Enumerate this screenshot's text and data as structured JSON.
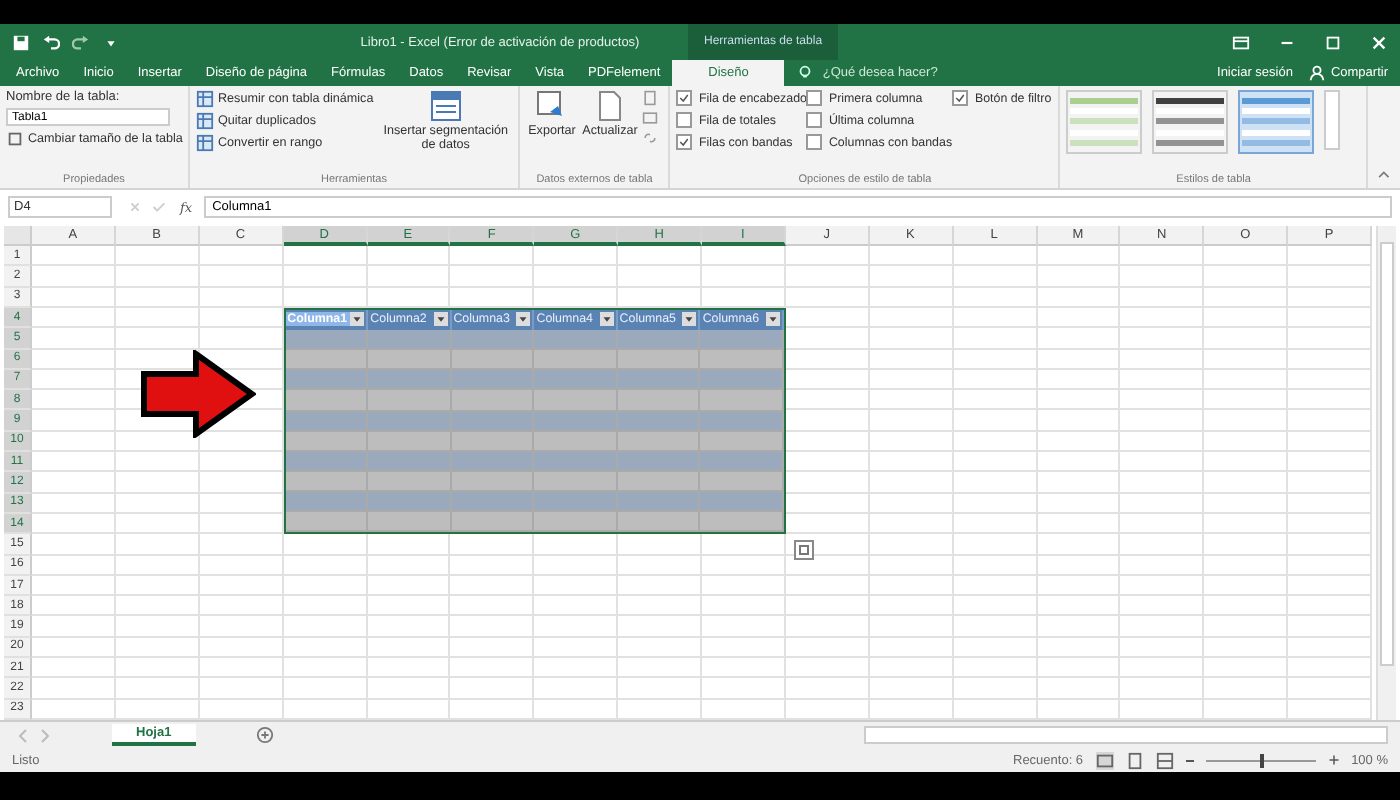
{
  "title_bar": {
    "title": "Libro1 - Excel (Error de activación de productos)",
    "contextual_tab": "Herramientas de tabla",
    "sign_in": "Iniciar sesión",
    "share": "Compartir"
  },
  "ribbon_tabs": [
    {
      "label": "Archivo",
      "selected": false
    },
    {
      "label": "Inicio",
      "selected": false
    },
    {
      "label": "Insertar",
      "selected": false
    },
    {
      "label": "Diseño de página",
      "selected": false
    },
    {
      "label": "Fórmulas",
      "selected": false
    },
    {
      "label": "Datos",
      "selected": false
    },
    {
      "label": "Revisar",
      "selected": false
    },
    {
      "label": "Vista",
      "selected": false
    },
    {
      "label": "PDFelement",
      "selected": false
    },
    {
      "label": "Diseño",
      "selected": true
    }
  ],
  "tell_me": {
    "placeholder": "¿Qué desea hacer?"
  },
  "properties": {
    "name_label": "Nombre de la tabla:",
    "name_value": "Tabla1",
    "resize": "Cambiar tamaño de la tabla",
    "group": "Propiedades"
  },
  "tools": {
    "items": [
      "Resumir con tabla dinámica",
      "Quitar duplicados",
      "Convertir en rango"
    ],
    "slicer": "Insertar segmentación de datos",
    "group": "Herramientas"
  },
  "external": {
    "export": "Exportar",
    "refresh": "Actualizar",
    "group": "Datos externos de tabla"
  },
  "style_options": {
    "columns": [
      [
        {
          "label": "Fila de encabezado",
          "checked": true
        },
        {
          "label": "Fila de totales",
          "checked": false
        },
        {
          "label": "Filas con bandas",
          "checked": true
        }
      ],
      [
        {
          "label": "Primera columna",
          "checked": false
        },
        {
          "label": "Última columna",
          "checked": false
        },
        {
          "label": "Columnas con bandas",
          "checked": false
        }
      ],
      [
        {
          "label": "Botón de filtro",
          "checked": true
        }
      ]
    ],
    "group": "Opciones de estilo de tabla"
  },
  "table_styles": {
    "items": [
      {
        "color": "#a9d08e",
        "selected": false
      },
      {
        "color": "#404040",
        "selected": false
      },
      {
        "color": "#5b9bd5",
        "selected": true
      }
    ],
    "group": "Estilos de tabla"
  },
  "formula_bar": {
    "name_box": "D4",
    "function_symbol": "fx",
    "formula": "Columna1"
  },
  "sheet": {
    "columns": [
      {
        "label": "A",
        "in_table": false
      },
      {
        "label": "B",
        "in_table": false
      },
      {
        "label": "C",
        "in_table": false
      },
      {
        "label": "D",
        "in_table": true
      },
      {
        "label": "E",
        "in_table": true
      },
      {
        "label": "F",
        "in_table": true
      },
      {
        "label": "G",
        "in_table": true
      },
      {
        "label": "H",
        "in_table": true
      },
      {
        "label": "I",
        "in_table": true
      },
      {
        "label": "J",
        "in_table": false
      },
      {
        "label": "K",
        "in_table": false
      },
      {
        "label": "L",
        "in_table": false
      },
      {
        "label": "M",
        "in_table": false
      },
      {
        "label": "N",
        "in_table": false
      },
      {
        "label": "O",
        "in_table": false
      },
      {
        "label": "P",
        "in_table": false
      }
    ],
    "rows": [
      {
        "label": "1",
        "kind": "plain"
      },
      {
        "label": "2",
        "kind": "plain"
      },
      {
        "label": "3",
        "kind": "plain"
      },
      {
        "label": "4",
        "kind": "table_header"
      },
      {
        "label": "5",
        "kind": "table_row"
      },
      {
        "label": "6",
        "kind": "table_row"
      },
      {
        "label": "7",
        "kind": "table_row"
      },
      {
        "label": "8",
        "kind": "table_row"
      },
      {
        "label": "9",
        "kind": "table_row"
      },
      {
        "label": "10",
        "kind": "table_row"
      },
      {
        "label": "11",
        "kind": "table_row"
      },
      {
        "label": "12",
        "kind": "table_row"
      },
      {
        "label": "13",
        "kind": "table_row"
      },
      {
        "label": "14",
        "kind": "table_row"
      },
      {
        "label": "15",
        "kind": "plain"
      },
      {
        "label": "16",
        "kind": "plain"
      },
      {
        "label": "17",
        "kind": "plain"
      },
      {
        "label": "18",
        "kind": "plain"
      },
      {
        "label": "19",
        "kind": "plain"
      },
      {
        "label": "20",
        "kind": "plain"
      },
      {
        "label": "21",
        "kind": "plain"
      },
      {
        "label": "22",
        "kind": "plain"
      },
      {
        "label": "23",
        "kind": "plain"
      }
    ],
    "table_headers": [
      {
        "label": "Columna1",
        "selected": true
      },
      {
        "label": "Columna2",
        "selected": false
      },
      {
        "label": "Columna3",
        "selected": false
      },
      {
        "label": "Columna4",
        "selected": false
      },
      {
        "label": "Columna5",
        "selected": false
      },
      {
        "label": "Columna6",
        "selected": false
      }
    ]
  },
  "sheet_tabs": [
    {
      "label": "Hoja1",
      "selected": true
    }
  ],
  "status_bar": {
    "status": "Listo",
    "count": "Recuento: 6",
    "zoom": "100 %",
    "zoom_slider": {
      "level": 0.5
    }
  }
}
